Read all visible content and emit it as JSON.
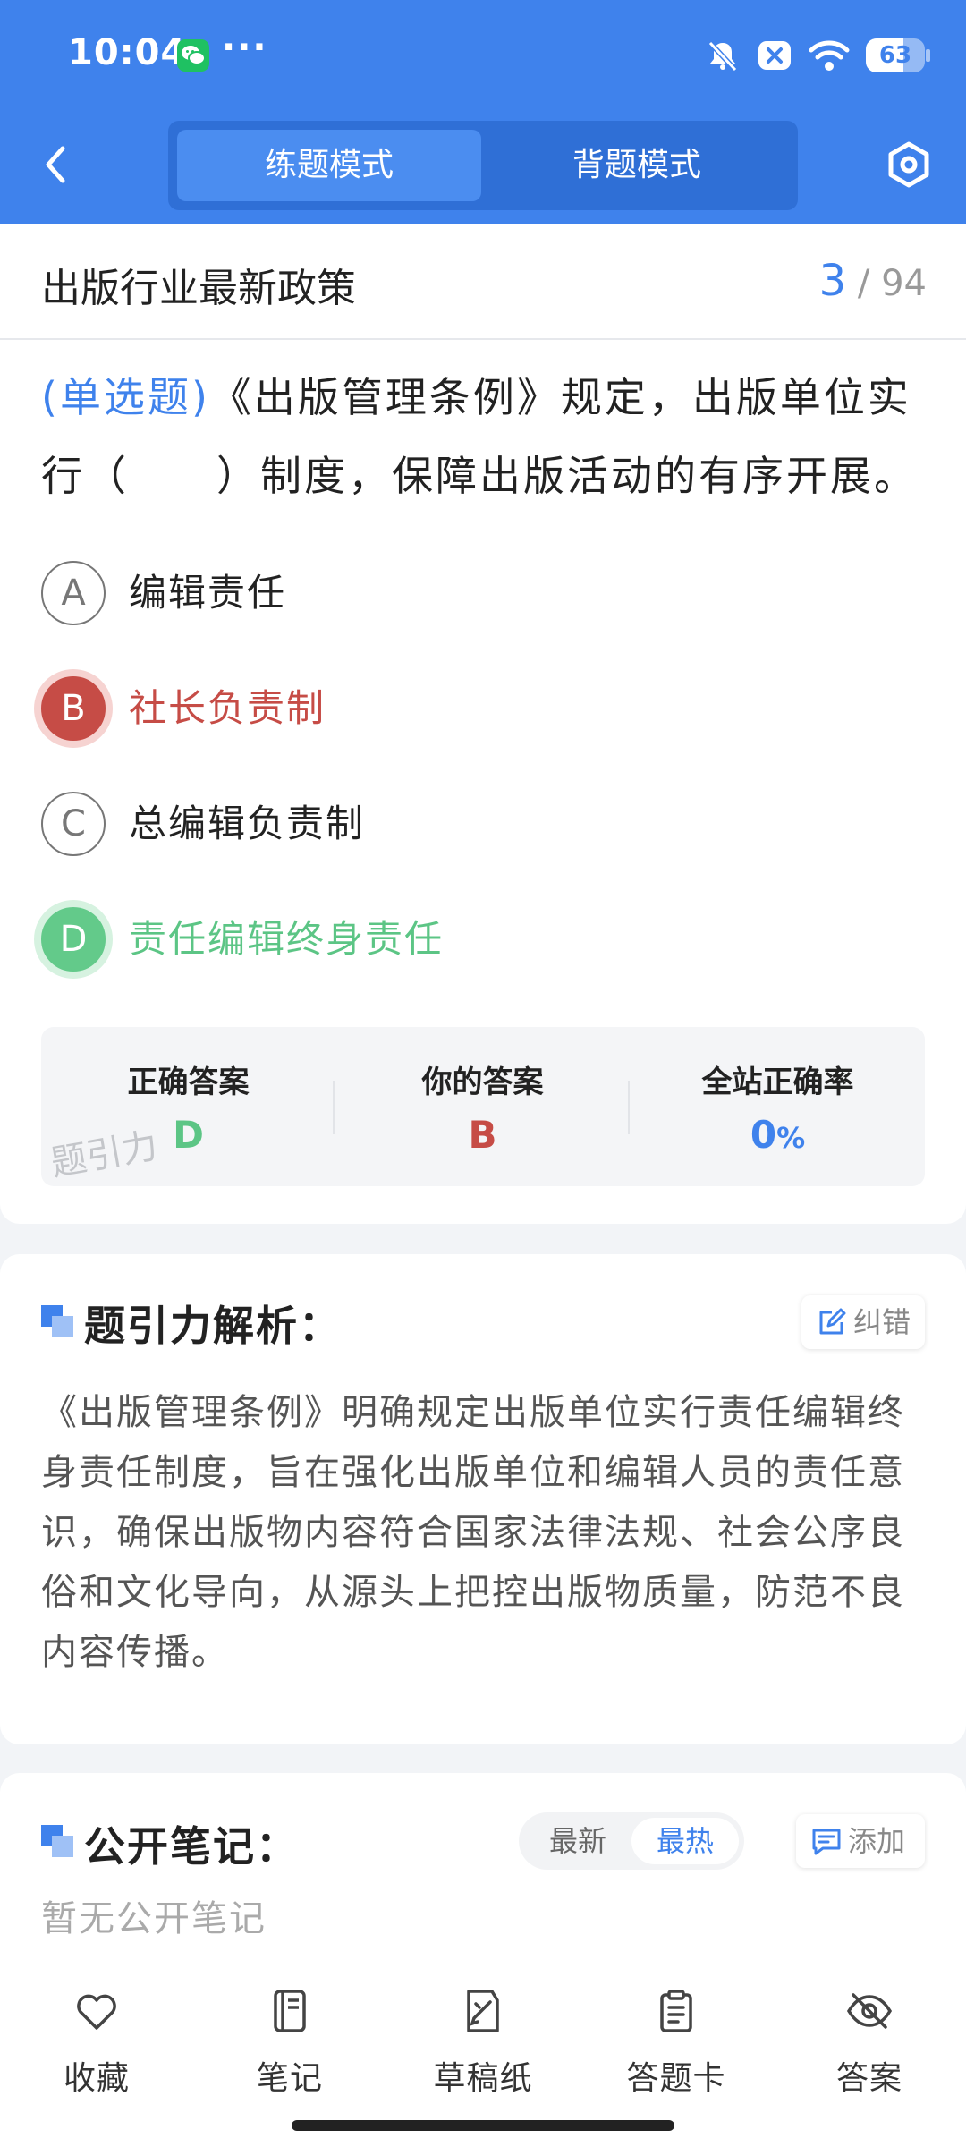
{
  "status_bar": {
    "time": "10:04",
    "more": "···",
    "battery": "63",
    "battery_level": 0.63,
    "icons": [
      "wechat-icon",
      "bell-off-icon",
      "close-box-icon",
      "wifi-icon",
      "battery-icon"
    ]
  },
  "header": {
    "back_icon": "chevron-left-icon",
    "tabs": [
      {
        "label": "练题模式",
        "active": true
      },
      {
        "label": "背题模式",
        "active": false
      }
    ],
    "settings_icon": "hexagon-gear-icon",
    "accent_color": "#3f82ec"
  },
  "question": {
    "chapter": "出版行业最新政策",
    "current": "3",
    "separator": "/",
    "total": "94",
    "type": "(单选题)",
    "stem_line1": "《出版管理条例》规定，出版单位实",
    "stem_line2": "行（　　）制度，保障出版活动的有序开展。",
    "options": [
      {
        "letter": "A",
        "text": "编辑责任",
        "state": "normal"
      },
      {
        "letter": "B",
        "text": "社长负责制",
        "state": "wrong"
      },
      {
        "letter": "C",
        "text": "总编辑负责制",
        "state": "normal"
      },
      {
        "letter": "D",
        "text": "责任编辑终身责任",
        "state": "correct"
      }
    ],
    "correct_color": "#5cc585",
    "wrong_color": "#c64c46"
  },
  "answer_summary": {
    "correct_label": "正确答案",
    "correct_value": "D",
    "yours_label": "你的答案",
    "yours_value": "B",
    "rate_label": "全站正确率",
    "rate_value": "0",
    "rate_unit": "%",
    "watermark": "题引力"
  },
  "analysis": {
    "title": "题引力解析：",
    "report_label": "纠错",
    "text": "《出版管理条例》明确规定出版单位实行责任编辑终身责任制度，旨在强化出版单位和编辑人员的责任意识，确保出版物内容符合国家法律法规、社会公序良俗和文化导向，从源头上把控出版物质量，防范不良内容传播。"
  },
  "notes": {
    "title": "公开笔记：",
    "sort_options": [
      {
        "label": "最新",
        "active": false
      },
      {
        "label": "最热",
        "active": true
      }
    ],
    "add_label": "添加",
    "empty_text": "暂无公开笔记"
  },
  "bottom_nav": [
    {
      "label": "收藏",
      "icon": "heart-icon"
    },
    {
      "label": "笔记",
      "icon": "notebook-icon"
    },
    {
      "label": "草稿纸",
      "icon": "draft-paper-icon"
    },
    {
      "label": "答题卡",
      "icon": "answer-card-icon"
    },
    {
      "label": "答案",
      "icon": "eye-off-icon"
    }
  ]
}
